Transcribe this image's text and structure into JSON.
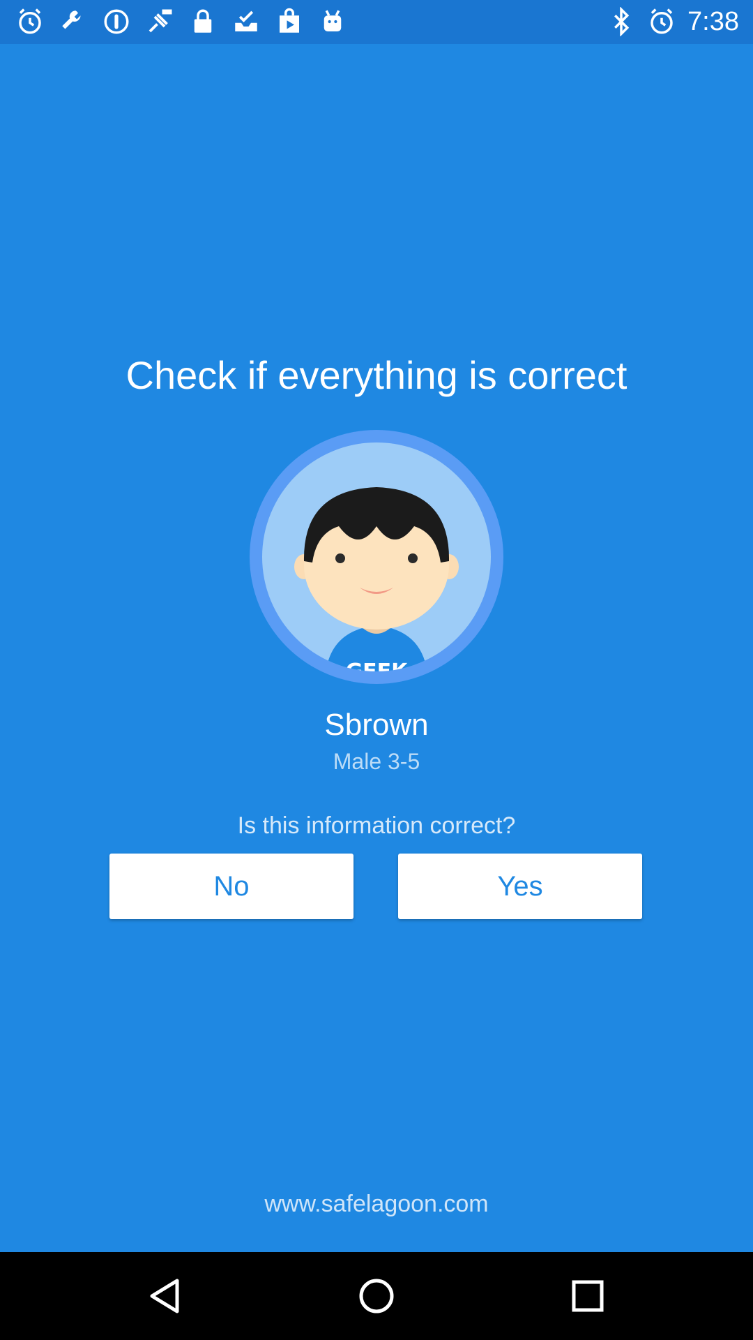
{
  "status_bar": {
    "time": "7:38",
    "left_icons": [
      "alarm-icon",
      "wrench-icon",
      "info-icon",
      "fake-gps-icon",
      "lock-icon",
      "inbox-check-icon",
      "play-store-icon",
      "android-icon"
    ],
    "right_icons": [
      "bluetooth-icon",
      "alarm-icon"
    ]
  },
  "main": {
    "title": "Check if everything is correct",
    "avatar": {
      "shirt_text": "GEEK"
    },
    "profile_name": "Sbrown",
    "profile_details": "Male 3-5",
    "question": "Is this information correct?",
    "no_label": "No",
    "yes_label": "Yes",
    "footer_url": "www.safelagoon.com"
  },
  "nav_bar": {
    "buttons": [
      "back-icon",
      "home-icon",
      "recent-apps-icon"
    ]
  },
  "colors": {
    "background": "#1f88e2",
    "status_bar": "#1a76d1",
    "button_bg": "#ffffff",
    "button_text": "#1f88e2",
    "nav_bar": "#000000"
  }
}
